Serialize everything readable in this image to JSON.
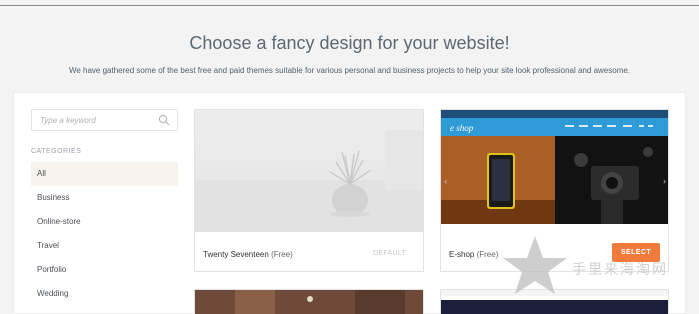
{
  "hero": {
    "title": "Choose a fancy design for your website!",
    "subtitle": "We have gathered some of the best free and paid themes suitable for various personal and business projects to help your site look professional and awesome."
  },
  "search": {
    "placeholder": "Type a keyword",
    "icon": "search-icon"
  },
  "categories": {
    "heading": "CATEGORIES",
    "items": [
      {
        "label": "All",
        "active": true
      },
      {
        "label": "Business"
      },
      {
        "label": "Online-store"
      },
      {
        "label": "Travel"
      },
      {
        "label": "Portfolio"
      },
      {
        "label": "Wedding"
      }
    ]
  },
  "themes": [
    {
      "name": "Twenty Seventeen",
      "price": "(Free)",
      "action": "DEFAULT"
    },
    {
      "name": "E-shop",
      "price": "(Free)",
      "action": "SELECT",
      "brand": "e shop"
    }
  ],
  "watermark": {
    "text": "手里来海淘网"
  },
  "colors": {
    "accent": "#f07b3c",
    "eshop_header": "#2e9ad6",
    "active_bg": "#f7f3ec"
  }
}
